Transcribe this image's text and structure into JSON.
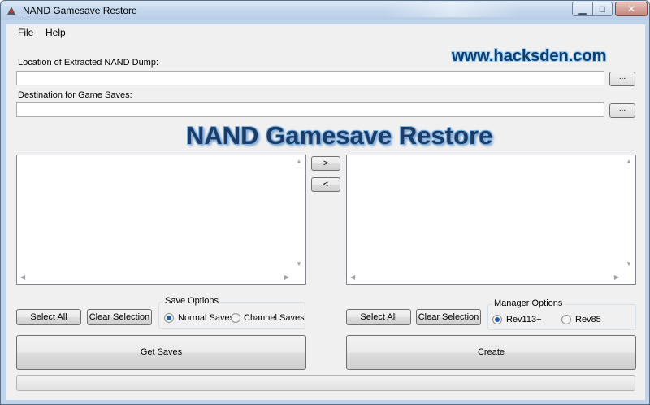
{
  "window": {
    "title": "NAND Gamesave Restore"
  },
  "menu": {
    "items": [
      "File",
      "Help"
    ]
  },
  "watermark": "www.hacksden.com",
  "banner": "NAND Gamesave Restore",
  "nand_dump": {
    "label": "Location of Extracted NAND Dump:",
    "value": "",
    "browse_label": "..."
  },
  "destination": {
    "label": "Destination for Game Saves:",
    "value": "",
    "browse_label": "..."
  },
  "transfer": {
    "right_label": ">",
    "left_label": "<"
  },
  "left_panel": {
    "select_all_label": "Select All",
    "clear_selection_label": "Clear Selection",
    "options_title": "Save Options",
    "options": [
      {
        "label": "Normal Saves",
        "checked": true
      },
      {
        "label": "Channel Saves",
        "checked": false
      }
    ],
    "action_label": "Get Saves"
  },
  "right_panel": {
    "select_all_label": "Select All",
    "clear_selection_label": "Clear Selection",
    "options_title": "Manager Options",
    "options": [
      {
        "label": "Rev113+",
        "checked": true
      },
      {
        "label": "Rev85",
        "checked": false
      }
    ],
    "action_label": "Create"
  },
  "progress": {
    "value": 0
  },
  "colors": {
    "accent": "#1c3b66",
    "watermark": "#0a3c6e",
    "titlebar": "#c4d7ec"
  }
}
